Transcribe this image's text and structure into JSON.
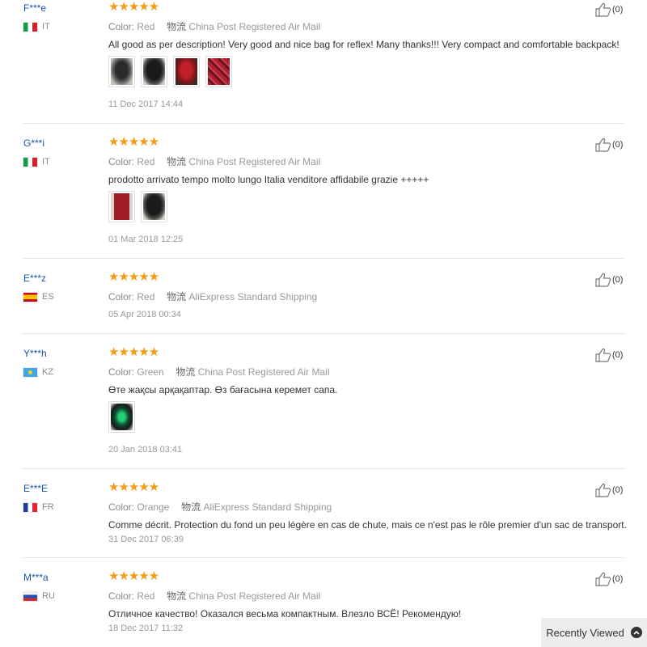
{
  "reviews": [
    {
      "user": "F***e",
      "country": "IT",
      "stars": "★★★★★",
      "color_label": "Color:",
      "color_value": "Red",
      "shipping_label": "物流",
      "shipping_value": "China Post Registered Air Mail",
      "text": "All good as per description! Very good and nice bag for reflex! Many thanks!!! Very compact and comfortable backpack!",
      "photos": [
        "black-backpack",
        "black-backpack",
        "red-backpack",
        "red-backpack"
      ],
      "date": "11 Dec 2017 14:44",
      "likes": "(0)"
    },
    {
      "user": "G***i",
      "country": "IT",
      "stars": "★★★★★",
      "color_label": "Color:",
      "color_value": "Red",
      "shipping_label": "物流",
      "shipping_value": "China Post Registered Air Mail",
      "text": "prodotto arrivato tempo molto lungo Italia venditore affidabile grazie +++++",
      "photos": [
        "red-backpack",
        "black-backpack"
      ],
      "date": "01 Mar 2018 12:25",
      "likes": "(0)"
    },
    {
      "user": "E***z",
      "country": "ES",
      "stars": "★★★★★",
      "color_label": "Color:",
      "color_value": "Red",
      "shipping_label": "物流",
      "shipping_value": "AliExpress Standard Shipping",
      "text": "",
      "photos": [],
      "date": "05 Apr 2018 00:34",
      "likes": "(0)"
    },
    {
      "user": "Y***h",
      "country": "KZ",
      "stars": "★★★★★",
      "color_label": "Color:",
      "color_value": "Green",
      "shipping_label": "物流",
      "shipping_value": "China Post Registered Air Mail",
      "text": "Өте жақсы арқақаптар. Өз бағасына керемет сапа.",
      "photos": [
        "green-backpack"
      ],
      "date": "20 Jan 2018 03:41",
      "likes": "(0)"
    },
    {
      "user": "E***E",
      "country": "FR",
      "stars": "★★★★★",
      "color_label": "Color:",
      "color_value": "Orange",
      "shipping_label": "物流",
      "shipping_value": "AliExpress Standard Shipping",
      "text": "Comme décrit. Protection du fond un peu légère en cas de chute, mais ce n'est pas le rôle premier d'un sac de transport.",
      "photos": [],
      "date": "31 Dec 2017 06:39",
      "likes": "(0)"
    },
    {
      "user": "M***a",
      "country": "RU",
      "stars": "★★★★★",
      "color_label": "Color:",
      "color_value": "Red",
      "shipping_label": "物流",
      "shipping_value": "China Post Registered Air Mail",
      "text": "Отличное качество! Оказался весьма компактным. Влезло ВСЁ! Рекомендую!",
      "photos": [],
      "date": "18 Dec 2017 11:32",
      "likes": "(0)"
    }
  ],
  "recently_viewed": {
    "label": "Recently Viewed",
    "icon": "chevron-up-icon"
  },
  "colors": {
    "star": "#f39c12",
    "username": "#1a55a3",
    "muted": "#999999",
    "divider": "#e6e6e6"
  }
}
